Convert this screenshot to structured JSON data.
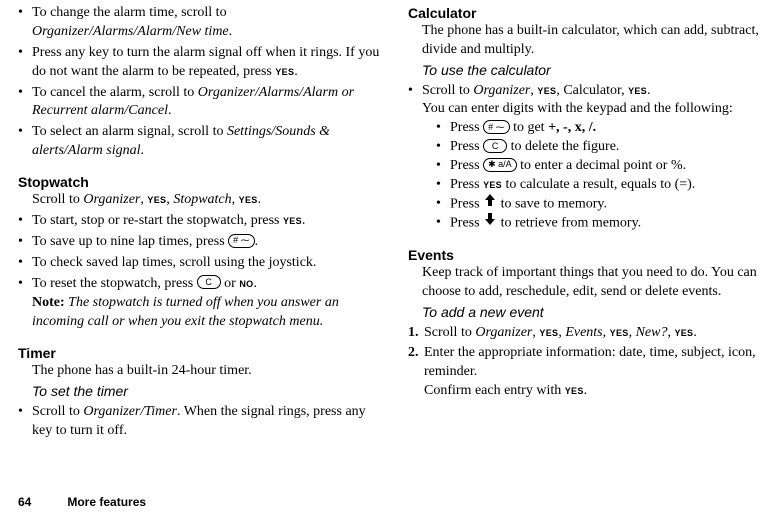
{
  "left": {
    "bullets1": [
      {
        "pre": "To change the alarm time, scroll to ",
        "it": "Organizer/Alarms/Alarm/New time",
        "post": "."
      },
      {
        "pre": "Press any key to turn the alarm signal off when it rings. If you do not want the alarm to be repeated, press ",
        "btn": "YES",
        "post": "."
      },
      {
        "pre": "To cancel the alarm, scroll to ",
        "it": "Organizer/Alarms/Alarm or Recurrent alarm/Cancel",
        "post": "."
      },
      {
        "pre": "To select an alarm signal, scroll to ",
        "it": "Settings/Sounds & alerts/Alarm signal",
        "post": "."
      }
    ],
    "stopwatch_title": "Stopwatch",
    "stopwatch_intro_pre": "Scroll to ",
    "stopwatch_intro_it1": "Organizer",
    "stopwatch_intro_mid1": ", ",
    "stopwatch_intro_btn1": "YES",
    "stopwatch_intro_mid2": ", ",
    "stopwatch_intro_it2": "Stopwatch",
    "stopwatch_intro_mid3": ", ",
    "stopwatch_intro_btn2": "YES",
    "stopwatch_intro_post": ".",
    "stopwatch_bullets": [
      {
        "text_pre": "To start, stop or re-start the stopwatch, press ",
        "btn": "YES",
        "text_post": "."
      },
      {
        "text_pre": "To save up to nine lap times, press ",
        "key": "# ⁓",
        "text_post": "."
      },
      {
        "text": "To check saved lap times, scroll using the joystick."
      },
      {
        "text_pre": "To reset the stopwatch, press ",
        "key": "C",
        "mid": " or ",
        "btn": "NO",
        "text_post": "."
      }
    ],
    "note_label": "Note:",
    "note_body": " The stopwatch is turned off when you answer an incoming call or when you exit the stopwatch menu.",
    "timer_title": "Timer",
    "timer_text": "The phone has a built-in 24-hour timer.",
    "timer_sub_title": "To set the timer",
    "timer_bullet_pre": "Scroll to ",
    "timer_bullet_it": "Organizer/Timer",
    "timer_bullet_post": ". When the signal rings, press any key to turn it off."
  },
  "right": {
    "calc_title": "Calculator",
    "calc_text": "The phone has a built-in calculator, which can add, subtract, divide and multiply.",
    "calc_sub_title": "To use the calculator",
    "calc_first_pre": "Scroll to ",
    "calc_first_it": "Organizer",
    "calc_first_mid1": ", ",
    "calc_first_btn1": "YES",
    "calc_first_mid2": ", Calculator, ",
    "calc_first_btn2": "YES",
    "calc_first_post": ".",
    "calc_intro2": "You can enter digits with the keypad and the following:",
    "calc_sub_bullets": {
      "b1_pre": "Press ",
      "b1_key": "# ⁓",
      "b1_post": " to get ",
      "b1_ops": "+, -, x, /.",
      "b2_pre": "Press ",
      "b2_key": "C",
      "b2_post": " to delete the figure.",
      "b3_pre": "Press ",
      "b3_key": "✱ a/A",
      "b3_post": " to enter a decimal point or %.",
      "b4_pre": "Press ",
      "b4_btn": "YES",
      "b4_post": " to calculate a result, equals to (=).",
      "b5_pre": "Press ",
      "b5_post": " to save to memory.",
      "b6_pre": "Press ",
      "b6_post": " to retrieve from memory."
    },
    "events_title": "Events",
    "events_text": "Keep track of important things that you need to do. You can choose to add, reschedule, edit, send or delete events.",
    "events_sub_title": "To add a new event",
    "events_step1_pre": "Scroll to ",
    "events_step1_it1": "Organizer",
    "events_step1_mid1": ", ",
    "events_step1_btn1": "YES",
    "events_step1_mid2": ", ",
    "events_step1_it2": "Events",
    "events_step1_mid3": ", ",
    "events_step1_btn2": "YES",
    "events_step1_mid4": ", ",
    "events_step1_it3": "New?",
    "events_step1_mid5": ", ",
    "events_step1_btn3": "YES",
    "events_step1_post": ".",
    "events_step2_line1": "Enter the appropriate information: date, time, subject, icon, reminder.",
    "events_step2_line2_pre": "Confirm each entry with ",
    "events_step2_line2_btn": "YES",
    "events_step2_line2_post": "."
  },
  "footer": {
    "page": "64",
    "section": "More features"
  },
  "nums": {
    "n1": "1.",
    "n2": "2."
  }
}
